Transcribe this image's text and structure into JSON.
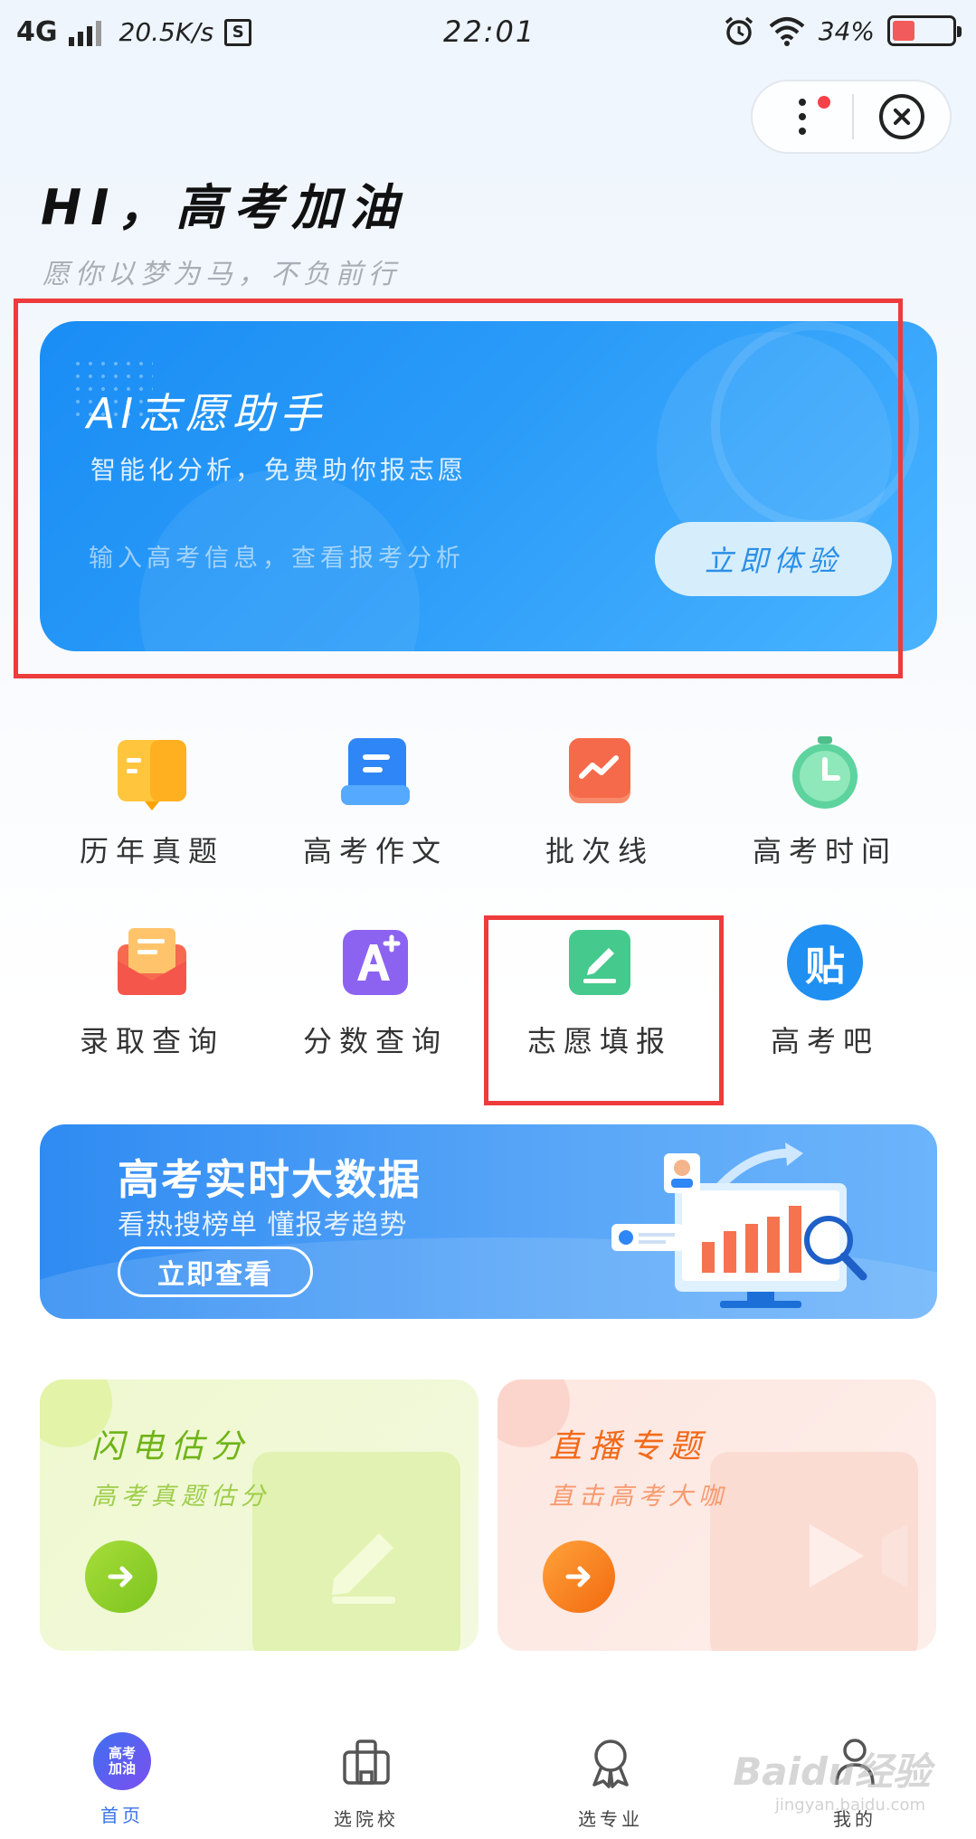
{
  "status_bar": {
    "network": "4G",
    "speed": "20.5K/s",
    "sim_icon": "S",
    "time": "22:01",
    "battery": "34%",
    "battery_level": 0.34
  },
  "capsule": {
    "more_icon": "more-dots-icon",
    "close_icon": "close-circle-icon"
  },
  "header": {
    "greeting": "HI，高考加油",
    "subtitle": "愿你以梦为马，不负前行"
  },
  "ai_card": {
    "title": "AI志愿助手",
    "desc": "智能化分析，免费助你报志愿",
    "hint": "输入高考信息，查看报考分析",
    "button": "立即体验"
  },
  "grid": [
    {
      "label": "历年真题",
      "icon": "book-icon",
      "color": "#ffc53d"
    },
    {
      "label": "高考作文",
      "icon": "document-icon",
      "color": "#2f86f6"
    },
    {
      "label": "批次线",
      "icon": "trend-chart-icon",
      "color": "#f56a4a"
    },
    {
      "label": "高考时间",
      "icon": "timer-icon",
      "color": "#5dd39e"
    },
    {
      "label": "录取查询",
      "icon": "envelope-icon",
      "color": "#f66a50"
    },
    {
      "label": "分数查询",
      "icon": "a-plus-icon",
      "color": "#8c63f1"
    },
    {
      "label": "志愿填报",
      "icon": "edit-pen-icon",
      "color": "#45c98d"
    },
    {
      "label": "高考吧",
      "icon": "post-badge-icon",
      "color": "#1f8ff2",
      "glyph": "贴"
    }
  ],
  "data_banner": {
    "title": "高考实时大数据",
    "subtitle": "看热搜榜单 懂报考趋势",
    "button": "立即查看"
  },
  "cards": [
    {
      "title": "闪电估分",
      "subtitle": "高考真题估分",
      "color": "#7cc41f"
    },
    {
      "title": "直播专题",
      "subtitle": "直击高考大咖",
      "color": "#f77a1e"
    }
  ],
  "tabbar": {
    "tabs": [
      {
        "label": "首页",
        "icon": "app-logo-icon",
        "badge_text": "高考加油"
      },
      {
        "label": "选院校",
        "icon": "school-building-icon"
      },
      {
        "label": "选专业",
        "icon": "award-ribbon-icon"
      },
      {
        "label": "我的",
        "icon": "user-icon"
      }
    ]
  },
  "watermark": {
    "main": "Baidu经验",
    "sub": "jingyan.baidu.com"
  }
}
